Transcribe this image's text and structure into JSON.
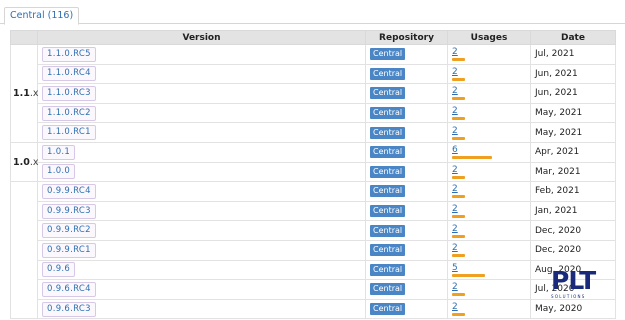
{
  "tab": {
    "label": "Central (116)"
  },
  "headers": {
    "version": "Version",
    "repository": "Repository",
    "usages": "Usages",
    "date": "Date"
  },
  "groups": [
    {
      "label": "1.1",
      "suffix": ".x"
    },
    {
      "label": "1.0",
      "suffix": ".x"
    },
    {
      "label": "",
      "suffix": ""
    }
  ],
  "rows": [
    {
      "version": "1.1.0.RC5",
      "repository": "Central",
      "usages": "2",
      "usage_level": 2,
      "date": "Jul, 2021"
    },
    {
      "version": "1.1.0.RC4",
      "repository": "Central",
      "usages": "2",
      "usage_level": 2,
      "date": "Jun, 2021"
    },
    {
      "version": "1.1.0.RC3",
      "repository": "Central",
      "usages": "2",
      "usage_level": 2,
      "date": "Jun, 2021"
    },
    {
      "version": "1.1.0.RC2",
      "repository": "Central",
      "usages": "2",
      "usage_level": 2,
      "date": "May, 2021"
    },
    {
      "version": "1.1.0.RC1",
      "repository": "Central",
      "usages": "2",
      "usage_level": 2,
      "date": "May, 2021"
    },
    {
      "version": "1.0.1",
      "repository": "Central",
      "usages": "6",
      "usage_level": 6,
      "date": "Apr, 2021"
    },
    {
      "version": "1.0.0",
      "repository": "Central",
      "usages": "2",
      "usage_level": 2,
      "date": "Mar, 2021"
    },
    {
      "version": "0.9.9.RC4",
      "repository": "Central",
      "usages": "2",
      "usage_level": 2,
      "date": "Feb, 2021"
    },
    {
      "version": "0.9.9.RC3",
      "repository": "Central",
      "usages": "2",
      "usage_level": 2,
      "date": "Jan, 2021"
    },
    {
      "version": "0.9.9.RC2",
      "repository": "Central",
      "usages": "2",
      "usage_level": 2,
      "date": "Dec, 2020"
    },
    {
      "version": "0.9.9.RC1",
      "repository": "Central",
      "usages": "2",
      "usage_level": 2,
      "date": "Dec, 2020"
    },
    {
      "version": "0.9.6",
      "repository": "Central",
      "usages": "5",
      "usage_level": 5,
      "date": "Aug, 2020"
    },
    {
      "version": "0.9.6.RC4",
      "repository": "Central",
      "usages": "2",
      "usage_level": 2,
      "date": "Jul, 2020"
    },
    {
      "version": "0.9.6.RC3",
      "repository": "Central",
      "usages": "2",
      "usage_level": 2,
      "date": "May, 2020"
    }
  ],
  "watermark": {
    "big": "PLT",
    "small": "SOLUTIONS"
  },
  "colors": {
    "accent": "#2f6fb0",
    "repo_badge": "#4a86c5",
    "usage_bar": "#f0a020",
    "header_bg": "#e3e3e3"
  }
}
